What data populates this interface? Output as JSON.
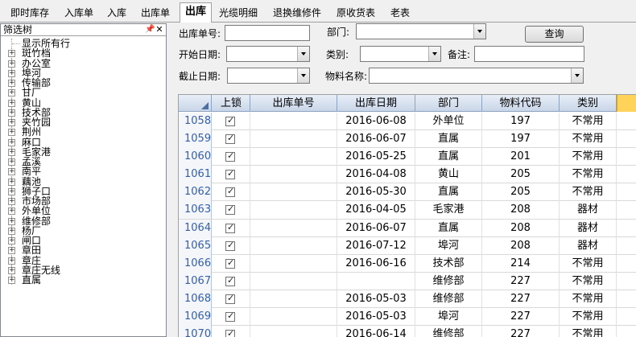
{
  "tabs": [
    "即时库存",
    "入库单",
    "入库",
    "出库单",
    "出库",
    "光缆明细",
    "退换维修件",
    "原收货表",
    "老表"
  ],
  "active_tab": "出库",
  "tree": {
    "title": "筛选树",
    "pin_icon": "pin-icon",
    "close_icon": "close-icon",
    "items": [
      {
        "label": "显示所有行",
        "expandable": false
      },
      {
        "label": "斑竹档",
        "expandable": true
      },
      {
        "label": "办公室",
        "expandable": true
      },
      {
        "label": "埠河",
        "expandable": true
      },
      {
        "label": "传输部",
        "expandable": true
      },
      {
        "label": "甘厂",
        "expandable": true
      },
      {
        "label": "黄山",
        "expandable": true
      },
      {
        "label": "技术部",
        "expandable": true
      },
      {
        "label": "夹竹园",
        "expandable": true
      },
      {
        "label": "荆州",
        "expandable": true
      },
      {
        "label": "麻口",
        "expandable": true
      },
      {
        "label": "毛家港",
        "expandable": true
      },
      {
        "label": "孟溪",
        "expandable": true
      },
      {
        "label": "南平",
        "expandable": true
      },
      {
        "label": "藕池",
        "expandable": true
      },
      {
        "label": "狮子口",
        "expandable": true
      },
      {
        "label": "市场部",
        "expandable": true
      },
      {
        "label": "外单位",
        "expandable": true
      },
      {
        "label": "维修部",
        "expandable": true
      },
      {
        "label": "杨厂",
        "expandable": true
      },
      {
        "label": "闸口",
        "expandable": true
      },
      {
        "label": "章田",
        "expandable": true
      },
      {
        "label": "章庄",
        "expandable": true
      },
      {
        "label": "章庄无线",
        "expandable": true
      },
      {
        "label": "直属",
        "expandable": true
      }
    ]
  },
  "filters": {
    "outbound_no_label": "出库单号:",
    "outbound_no_value": "",
    "dept_label": "部门:",
    "dept_value": "",
    "start_date_label": "开始日期:",
    "start_date_value": "",
    "category_label": "类别:",
    "category_value": "",
    "remark_label": "备注:",
    "remark_value": "",
    "end_date_label": "截止日期:",
    "end_date_value": "",
    "material_name_label": "物料名称:",
    "material_name_value": "",
    "query_button": "查询"
  },
  "grid": {
    "columns": [
      "上锁",
      "出库单号",
      "出库日期",
      "部门",
      "物料代码",
      "类别"
    ],
    "rows": [
      {
        "num": "1058",
        "locked": true,
        "no": "",
        "date": "2016-06-08",
        "dept": "外单位",
        "code": "197",
        "category": "不常用"
      },
      {
        "num": "1059",
        "locked": true,
        "no": "",
        "date": "2016-06-07",
        "dept": "直属",
        "code": "197",
        "category": "不常用"
      },
      {
        "num": "1060",
        "locked": true,
        "no": "",
        "date": "2016-05-25",
        "dept": "直属",
        "code": "201",
        "category": "不常用"
      },
      {
        "num": "1061",
        "locked": true,
        "no": "",
        "date": "2016-04-08",
        "dept": "黄山",
        "code": "205",
        "category": "不常用"
      },
      {
        "num": "1062",
        "locked": true,
        "no": "",
        "date": "2016-05-30",
        "dept": "直属",
        "code": "205",
        "category": "不常用"
      },
      {
        "num": "1063",
        "locked": true,
        "no": "",
        "date": "2016-04-05",
        "dept": "毛家港",
        "code": "208",
        "category": "器材"
      },
      {
        "num": "1064",
        "locked": true,
        "no": "",
        "date": "2016-06-07",
        "dept": "直属",
        "code": "208",
        "category": "器材"
      },
      {
        "num": "1065",
        "locked": true,
        "no": "",
        "date": "2016-07-12",
        "dept": "埠河",
        "code": "208",
        "category": "器材"
      },
      {
        "num": "1066",
        "locked": true,
        "no": "",
        "date": "2016-06-16",
        "dept": "技术部",
        "code": "214",
        "category": "不常用"
      },
      {
        "num": "1067",
        "locked": true,
        "no": "",
        "date": "",
        "dept": "维修部",
        "code": "227",
        "category": "不常用"
      },
      {
        "num": "1068",
        "locked": true,
        "no": "",
        "date": "2016-05-03",
        "dept": "维修部",
        "code": "227",
        "category": "不常用"
      },
      {
        "num": "1069",
        "locked": true,
        "no": "",
        "date": "2016-05-03",
        "dept": "埠河",
        "code": "227",
        "category": "不常用"
      },
      {
        "num": "1070",
        "locked": true,
        "no": "",
        "date": "2016-06-14",
        "dept": "维修部",
        "code": "227",
        "category": "不常用"
      }
    ]
  }
}
